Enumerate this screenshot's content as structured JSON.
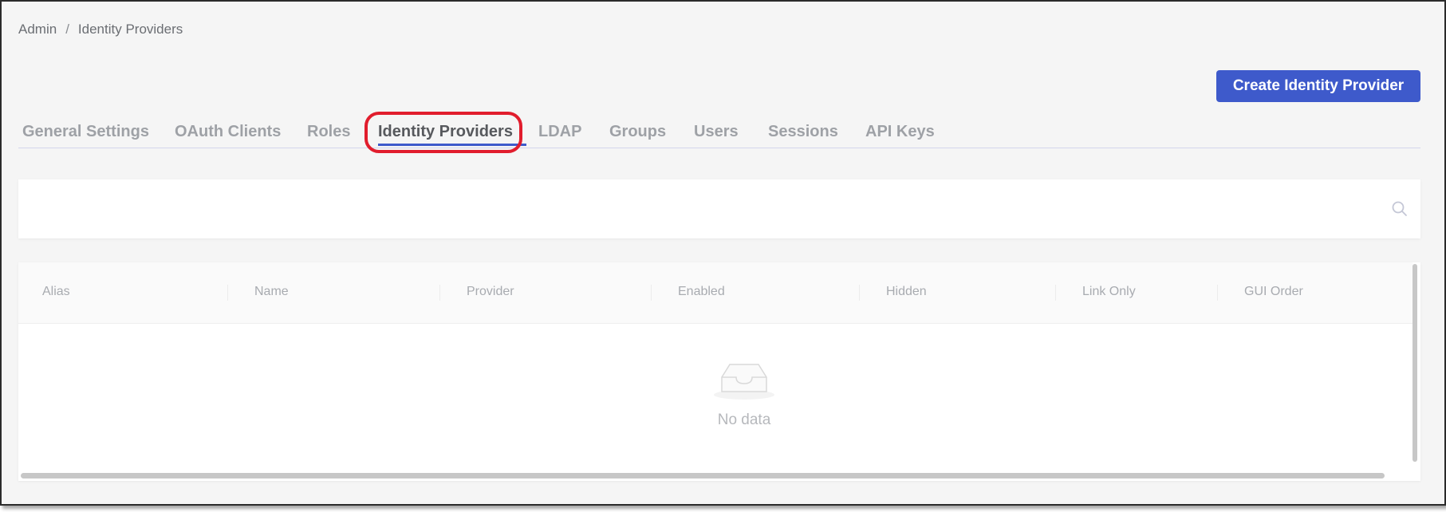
{
  "breadcrumb": {
    "items": [
      "Admin",
      "Identity Providers"
    ],
    "separator": "/"
  },
  "header": {
    "create_button_label": "Create Identity Provider"
  },
  "tabs": [
    {
      "label": "General Settings",
      "active": false
    },
    {
      "label": "OAuth Clients",
      "active": false
    },
    {
      "label": "Roles",
      "active": false
    },
    {
      "label": "Identity Providers",
      "active": true
    },
    {
      "label": "LDAP",
      "active": false
    },
    {
      "label": "Groups",
      "active": false
    },
    {
      "label": "Users",
      "active": false
    },
    {
      "label": "Sessions",
      "active": false
    },
    {
      "label": "API Keys",
      "active": false
    }
  ],
  "search": {
    "value": "",
    "placeholder": "",
    "icon": "search-icon"
  },
  "table": {
    "columns": [
      "Alias",
      "Name",
      "Provider",
      "Enabled",
      "Hidden",
      "Link Only",
      "GUI Order"
    ],
    "rows": [],
    "empty_text": "No data",
    "empty_icon": "empty-inbox-icon"
  },
  "colors": {
    "accent": "#3e5acb",
    "highlight": "#e11d2d",
    "background": "#f5f5f5",
    "tab_inactive": "#9ea1a6",
    "tab_active": "#57595d"
  }
}
